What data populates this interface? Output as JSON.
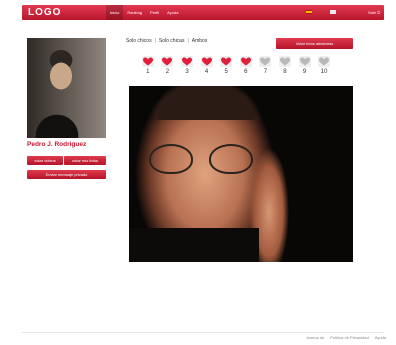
{
  "header": {
    "logo": "LOGO",
    "nav": [
      {
        "label": "Inicio",
        "active": true
      },
      {
        "label": "Ranking"
      },
      {
        "label": "Perfil"
      },
      {
        "label": "Ayuda"
      }
    ],
    "logout_label": "Salir"
  },
  "profile": {
    "name": "Pedro J. Rodriguez",
    "vote_videos_label": "votar videos",
    "vote_photos_label": "votar mis fotos",
    "send_message_label": "Enviar mensaje privado"
  },
  "filters": {
    "options": [
      "Solo chicos",
      "Solo chicas",
      "Ambos"
    ],
    "random_label": "Votar fotos aleatorias"
  },
  "rating": {
    "numbers": [
      "1",
      "2",
      "3",
      "4",
      "5",
      "6",
      "7",
      "8",
      "9",
      "10"
    ],
    "filled": 6,
    "filled_color": "#e0203a",
    "empty_color": "#b9b9b9"
  },
  "footer": {
    "links": [
      "Acerca de",
      "Política de Privacidad",
      "Ayuda"
    ]
  }
}
